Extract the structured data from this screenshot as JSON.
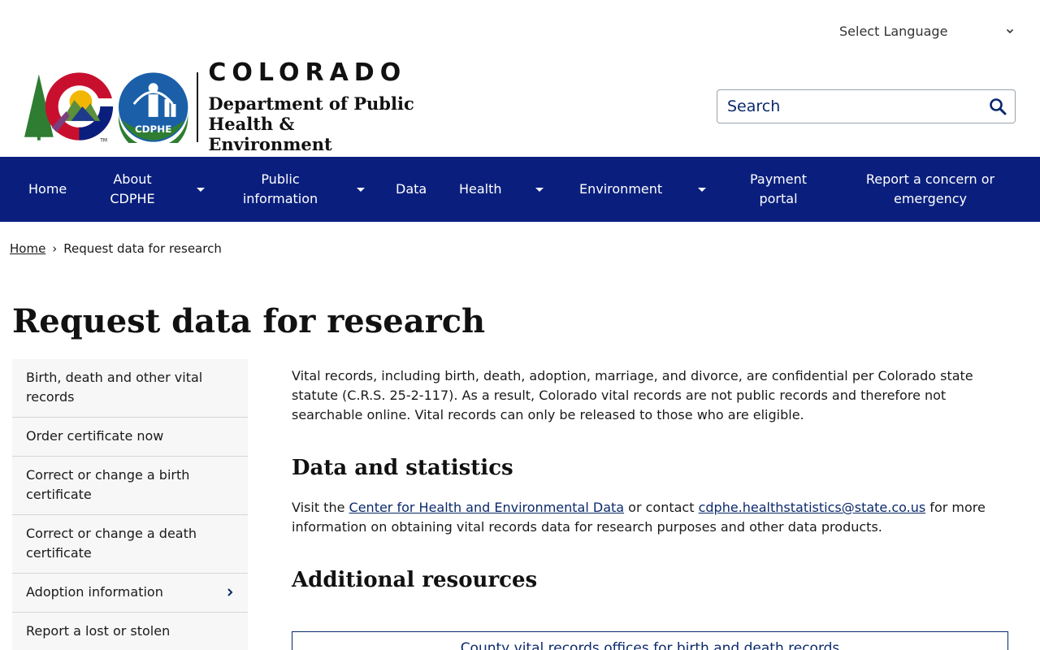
{
  "header": {
    "language_select": "Select Language",
    "logo": {
      "state": "COLORADO",
      "dept_line1": "Department of Public",
      "dept_line2": "Health & Environment",
      "badge_text": "CDPHE"
    },
    "search": {
      "placeholder": "Search"
    }
  },
  "nav": {
    "items": [
      {
        "label": "Home",
        "dropdown": false
      },
      {
        "label": "About CDPHE",
        "dropdown": true
      },
      {
        "label": "Public information",
        "dropdown": true
      },
      {
        "label": "Data",
        "dropdown": false
      },
      {
        "label": "Health",
        "dropdown": true
      },
      {
        "label": "Environment",
        "dropdown": true
      },
      {
        "label": "Payment portal",
        "dropdown": false
      },
      {
        "label": "Report a concern or emergency",
        "dropdown": false
      }
    ]
  },
  "breadcrumb": {
    "home": "Home",
    "separator": "›",
    "current": "Request data for research"
  },
  "page": {
    "title": "Request data for research"
  },
  "sidenav": {
    "items": [
      {
        "label": "Birth, death and other vital records"
      },
      {
        "label": "Order certificate now"
      },
      {
        "label": "Correct or change a birth certificate"
      },
      {
        "label": "Correct or change a death certificate"
      },
      {
        "label": "Adoption information",
        "has_children": true
      },
      {
        "label": "Report a lost or stolen"
      }
    ]
  },
  "main": {
    "intro": "Vital records, including birth, death, adoption, marriage, and divorce, are confidential per Colorado state statute (C.R.S. 25-2-117). As a result, Colorado vital records are not public records and therefore not searchable online. Vital records can only be released to those who are eligible.",
    "data_heading": "Data and statistics",
    "data_text_1": "Visit the ",
    "data_link_1": "Center for Health and Environmental Data",
    "data_text_2": " or contact ",
    "data_link_2": "cdphe.healthstatistics@state.co.us",
    "data_text_3": " for more information on obtaining vital records data for research purposes and other data products.",
    "resources_heading": "Additional resources",
    "resource_link": "County vital records offices for birth and death records"
  },
  "colors": {
    "nav_bg": "#0a1f7d",
    "link": "#0b2a6b",
    "sidenav_bg": "#f7f7f7"
  }
}
